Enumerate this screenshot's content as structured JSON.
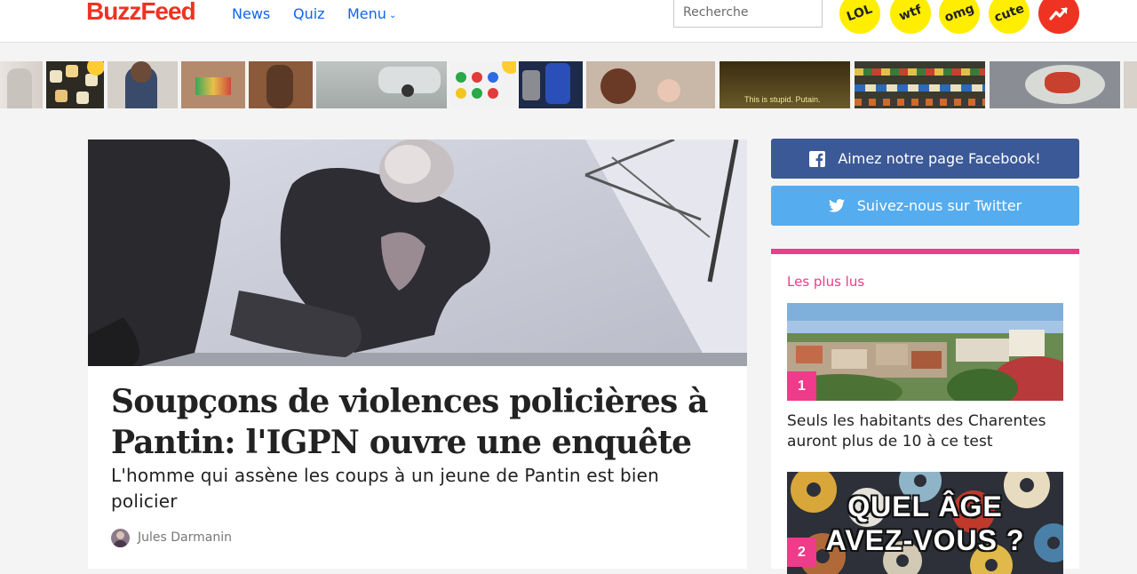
{
  "header": {
    "logo": "BuzzFeed",
    "nav": [
      {
        "label": "News"
      },
      {
        "label": "Quiz"
      },
      {
        "label": "Menu"
      }
    ],
    "search_placeholder": "Recherche",
    "badges": [
      "LOL",
      "wtf",
      "omg",
      "cute"
    ],
    "trending_icon": "trending-arrow-icon"
  },
  "strip": {
    "caption": "This is stupid. Putain."
  },
  "article": {
    "headline": "Soupçons de violences policières à Pantin: l'IGPN ouvre une enquête",
    "dek": "L'homme qui assène les coups à un jeune de Pantin est bien policier",
    "author": "Jules Darmanin"
  },
  "sidebar": {
    "facebook_label": "Aimez notre page Facebook!",
    "twitter_label": "Suivez-nous sur Twitter",
    "popular_title": "Les plus lus",
    "popular": [
      {
        "rank": "1",
        "title": "Seuls les habitants des Charentes auront plus de 10 à ce test"
      },
      {
        "rank": "2",
        "overlay_line1": "QUEL ÂGE",
        "overlay_line2": "AVEZ-VOUS ?"
      }
    ]
  },
  "colors": {
    "brand_red": "#ee3322",
    "link_blue": "#0f65ef",
    "badge_yellow": "#ffee00",
    "facebook": "#3b5997",
    "twitter": "#55acee",
    "accent_pink": "#ee3b8a"
  }
}
